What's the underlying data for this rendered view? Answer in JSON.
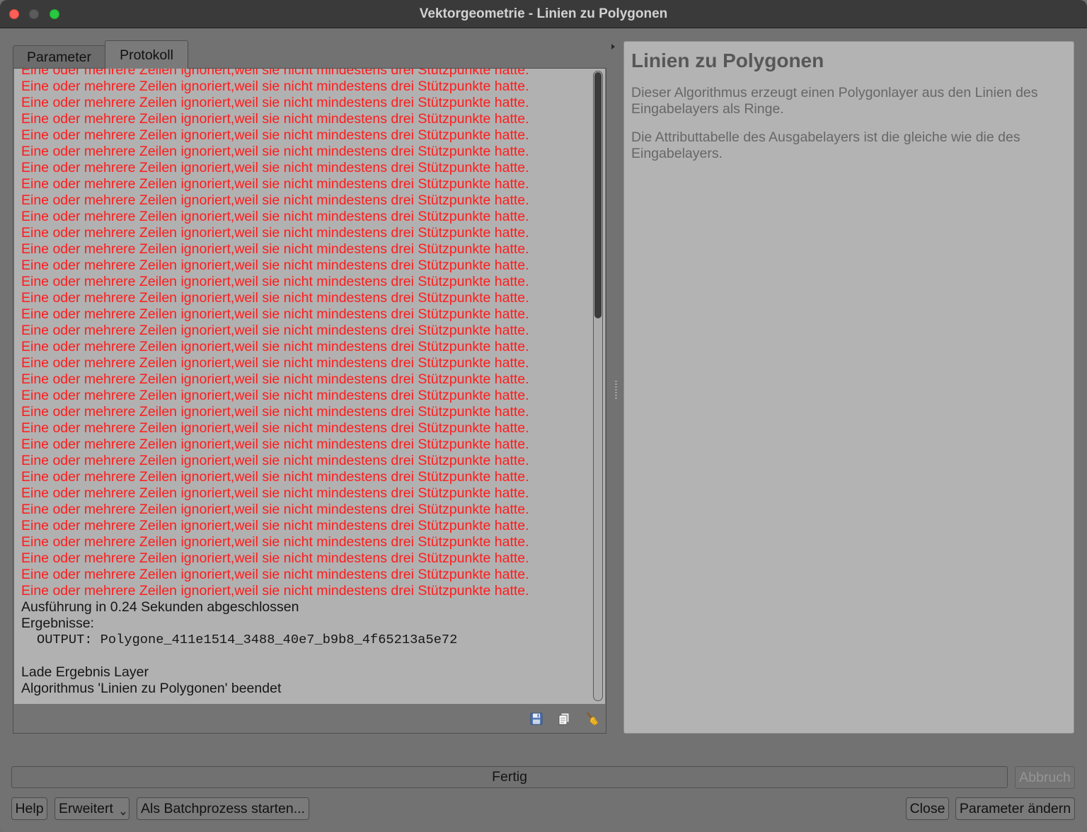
{
  "window": {
    "title": "Vektorgeometrie - Linien zu Polygonen"
  },
  "colors": {
    "error_text": "#ff1c1c",
    "traffic_close": "#ff5f57",
    "traffic_minimize": "#5b5b5b",
    "traffic_zoom": "#28c840"
  },
  "tabs": [
    {
      "label": "Parameter",
      "selected": false
    },
    {
      "label": "Protokoll",
      "selected": true
    }
  ],
  "log": {
    "error_lines": [
      "Eine oder mehrere Zeilen ignoriert,weil sie nicht mindestens drei Stützpunkte hatte.",
      "Eine oder mehrere Zeilen ignoriert,weil sie nicht mindestens drei Stützpunkte hatte.",
      "Eine oder mehrere Zeilen ignoriert,weil sie nicht mindestens drei Stützpunkte hatte.",
      "Eine oder mehrere Zeilen ignoriert,weil sie nicht mindestens drei Stützpunkte hatte.",
      "Eine oder mehrere Zeilen ignoriert,weil sie nicht mindestens drei Stützpunkte hatte.",
      "Eine oder mehrere Zeilen ignoriert,weil sie nicht mindestens drei Stützpunkte hatte.",
      "Eine oder mehrere Zeilen ignoriert,weil sie nicht mindestens drei Stützpunkte hatte.",
      "Eine oder mehrere Zeilen ignoriert,weil sie nicht mindestens drei Stützpunkte hatte.",
      "Eine oder mehrere Zeilen ignoriert,weil sie nicht mindestens drei Stützpunkte hatte.",
      "Eine oder mehrere Zeilen ignoriert,weil sie nicht mindestens drei Stützpunkte hatte.",
      "Eine oder mehrere Zeilen ignoriert,weil sie nicht mindestens drei Stützpunkte hatte.",
      "Eine oder mehrere Zeilen ignoriert,weil sie nicht mindestens drei Stützpunkte hatte.",
      "Eine oder mehrere Zeilen ignoriert,weil sie nicht mindestens drei Stützpunkte hatte.",
      "Eine oder mehrere Zeilen ignoriert,weil sie nicht mindestens drei Stützpunkte hatte.",
      "Eine oder mehrere Zeilen ignoriert,weil sie nicht mindestens drei Stützpunkte hatte.",
      "Eine oder mehrere Zeilen ignoriert,weil sie nicht mindestens drei Stützpunkte hatte.",
      "Eine oder mehrere Zeilen ignoriert,weil sie nicht mindestens drei Stützpunkte hatte.",
      "Eine oder mehrere Zeilen ignoriert,weil sie nicht mindestens drei Stützpunkte hatte.",
      "Eine oder mehrere Zeilen ignoriert,weil sie nicht mindestens drei Stützpunkte hatte.",
      "Eine oder mehrere Zeilen ignoriert,weil sie nicht mindestens drei Stützpunkte hatte.",
      "Eine oder mehrere Zeilen ignoriert,weil sie nicht mindestens drei Stützpunkte hatte.",
      "Eine oder mehrere Zeilen ignoriert,weil sie nicht mindestens drei Stützpunkte hatte.",
      "Eine oder mehrere Zeilen ignoriert,weil sie nicht mindestens drei Stützpunkte hatte.",
      "Eine oder mehrere Zeilen ignoriert,weil sie nicht mindestens drei Stützpunkte hatte.",
      "Eine oder mehrere Zeilen ignoriert,weil sie nicht mindestens drei Stützpunkte hatte.",
      "Eine oder mehrere Zeilen ignoriert,weil sie nicht mindestens drei Stützpunkte hatte.",
      "Eine oder mehrere Zeilen ignoriert,weil sie nicht mindestens drei Stützpunkte hatte.",
      "Eine oder mehrere Zeilen ignoriert,weil sie nicht mindestens drei Stützpunkte hatte.",
      "Eine oder mehrere Zeilen ignoriert,weil sie nicht mindestens drei Stützpunkte hatte.",
      "Eine oder mehrere Zeilen ignoriert,weil sie nicht mindestens drei Stützpunkte hatte.",
      "Eine oder mehrere Zeilen ignoriert,weil sie nicht mindestens drei Stützpunkte hatte.",
      "Eine oder mehrere Zeilen ignoriert,weil sie nicht mindestens drei Stützpunkte hatte.",
      "Eine oder mehrere Zeilen ignoriert,weil sie nicht mindestens drei Stützpunkte hatte."
    ],
    "summary_lines": [
      "Ausführung in 0.24 Sekunden abgeschlossen",
      "Ergebnisse:"
    ],
    "output_line": "OUTPUT: Polygone_411e1514_3488_40e7_b9b8_4f65213a5e72",
    "final_lines": [
      "Lade Ergebnis Layer",
      "Algorithmus 'Linien zu Polygonen' beendet"
    ],
    "toolbar": [
      {
        "icon": "save-icon"
      },
      {
        "icon": "copy-icon"
      },
      {
        "icon": "clear-log-icon"
      }
    ]
  },
  "help_panel": {
    "title": "Linien zu Polygonen",
    "paragraphs": [
      "Dieser Algorithmus erzeugt einen Polygonlayer aus den Linien des Eingabelayers als Ringe.",
      "Die Attributtabelle des Ausgabelayers ist die gleiche wie die des Eingabelayers."
    ]
  },
  "progress": {
    "label": "Fertig"
  },
  "buttons": {
    "cancel": {
      "label": "Abbruch",
      "enabled": false
    },
    "help": "Help",
    "advanced": {
      "label": "Erweitert",
      "icon": "chevron-down-icon"
    },
    "batch": "Als Batchprozess starten...",
    "close": "Close",
    "change_parameters": "Parameter ändern"
  }
}
